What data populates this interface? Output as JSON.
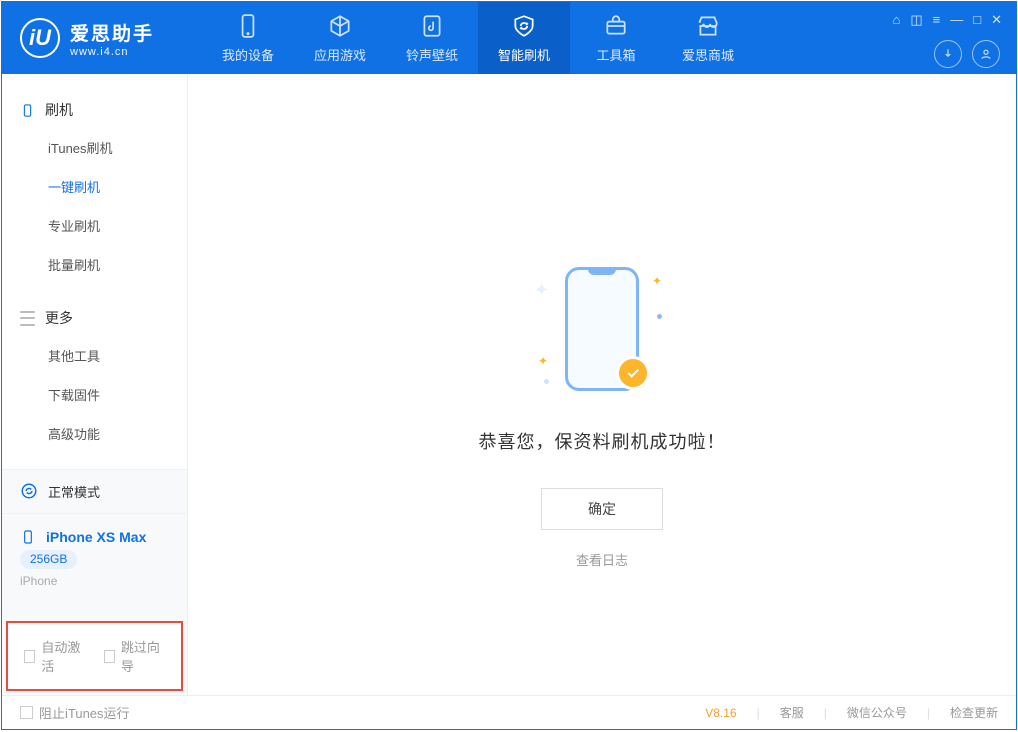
{
  "app": {
    "title": "爱思助手",
    "subtitle": "www.i4.cn"
  },
  "nav": {
    "items": [
      {
        "label": "我的设备"
      },
      {
        "label": "应用游戏"
      },
      {
        "label": "铃声壁纸"
      },
      {
        "label": "智能刷机"
      },
      {
        "label": "工具箱"
      },
      {
        "label": "爱思商城"
      }
    ]
  },
  "sidebar": {
    "group1_title": "刷机",
    "group1": [
      {
        "label": "iTunes刷机"
      },
      {
        "label": "一键刷机"
      },
      {
        "label": "专业刷机"
      },
      {
        "label": "批量刷机"
      }
    ],
    "group2_title": "更多",
    "group2": [
      {
        "label": "其他工具"
      },
      {
        "label": "下载固件"
      },
      {
        "label": "高级功能"
      }
    ],
    "mode_label": "正常模式",
    "device_name": "iPhone XS Max",
    "device_capacity": "256GB",
    "device_type": "iPhone",
    "cb_auto_activate": "自动激活",
    "cb_skip_guide": "跳过向导"
  },
  "main": {
    "success_message": "恭喜您，保资料刷机成功啦！",
    "ok_button": "确定",
    "view_log": "查看日志"
  },
  "status": {
    "block_itunes": "阻止iTunes运行",
    "version": "V8.16",
    "help": "客服",
    "wechat": "微信公众号",
    "update": "检查更新"
  }
}
